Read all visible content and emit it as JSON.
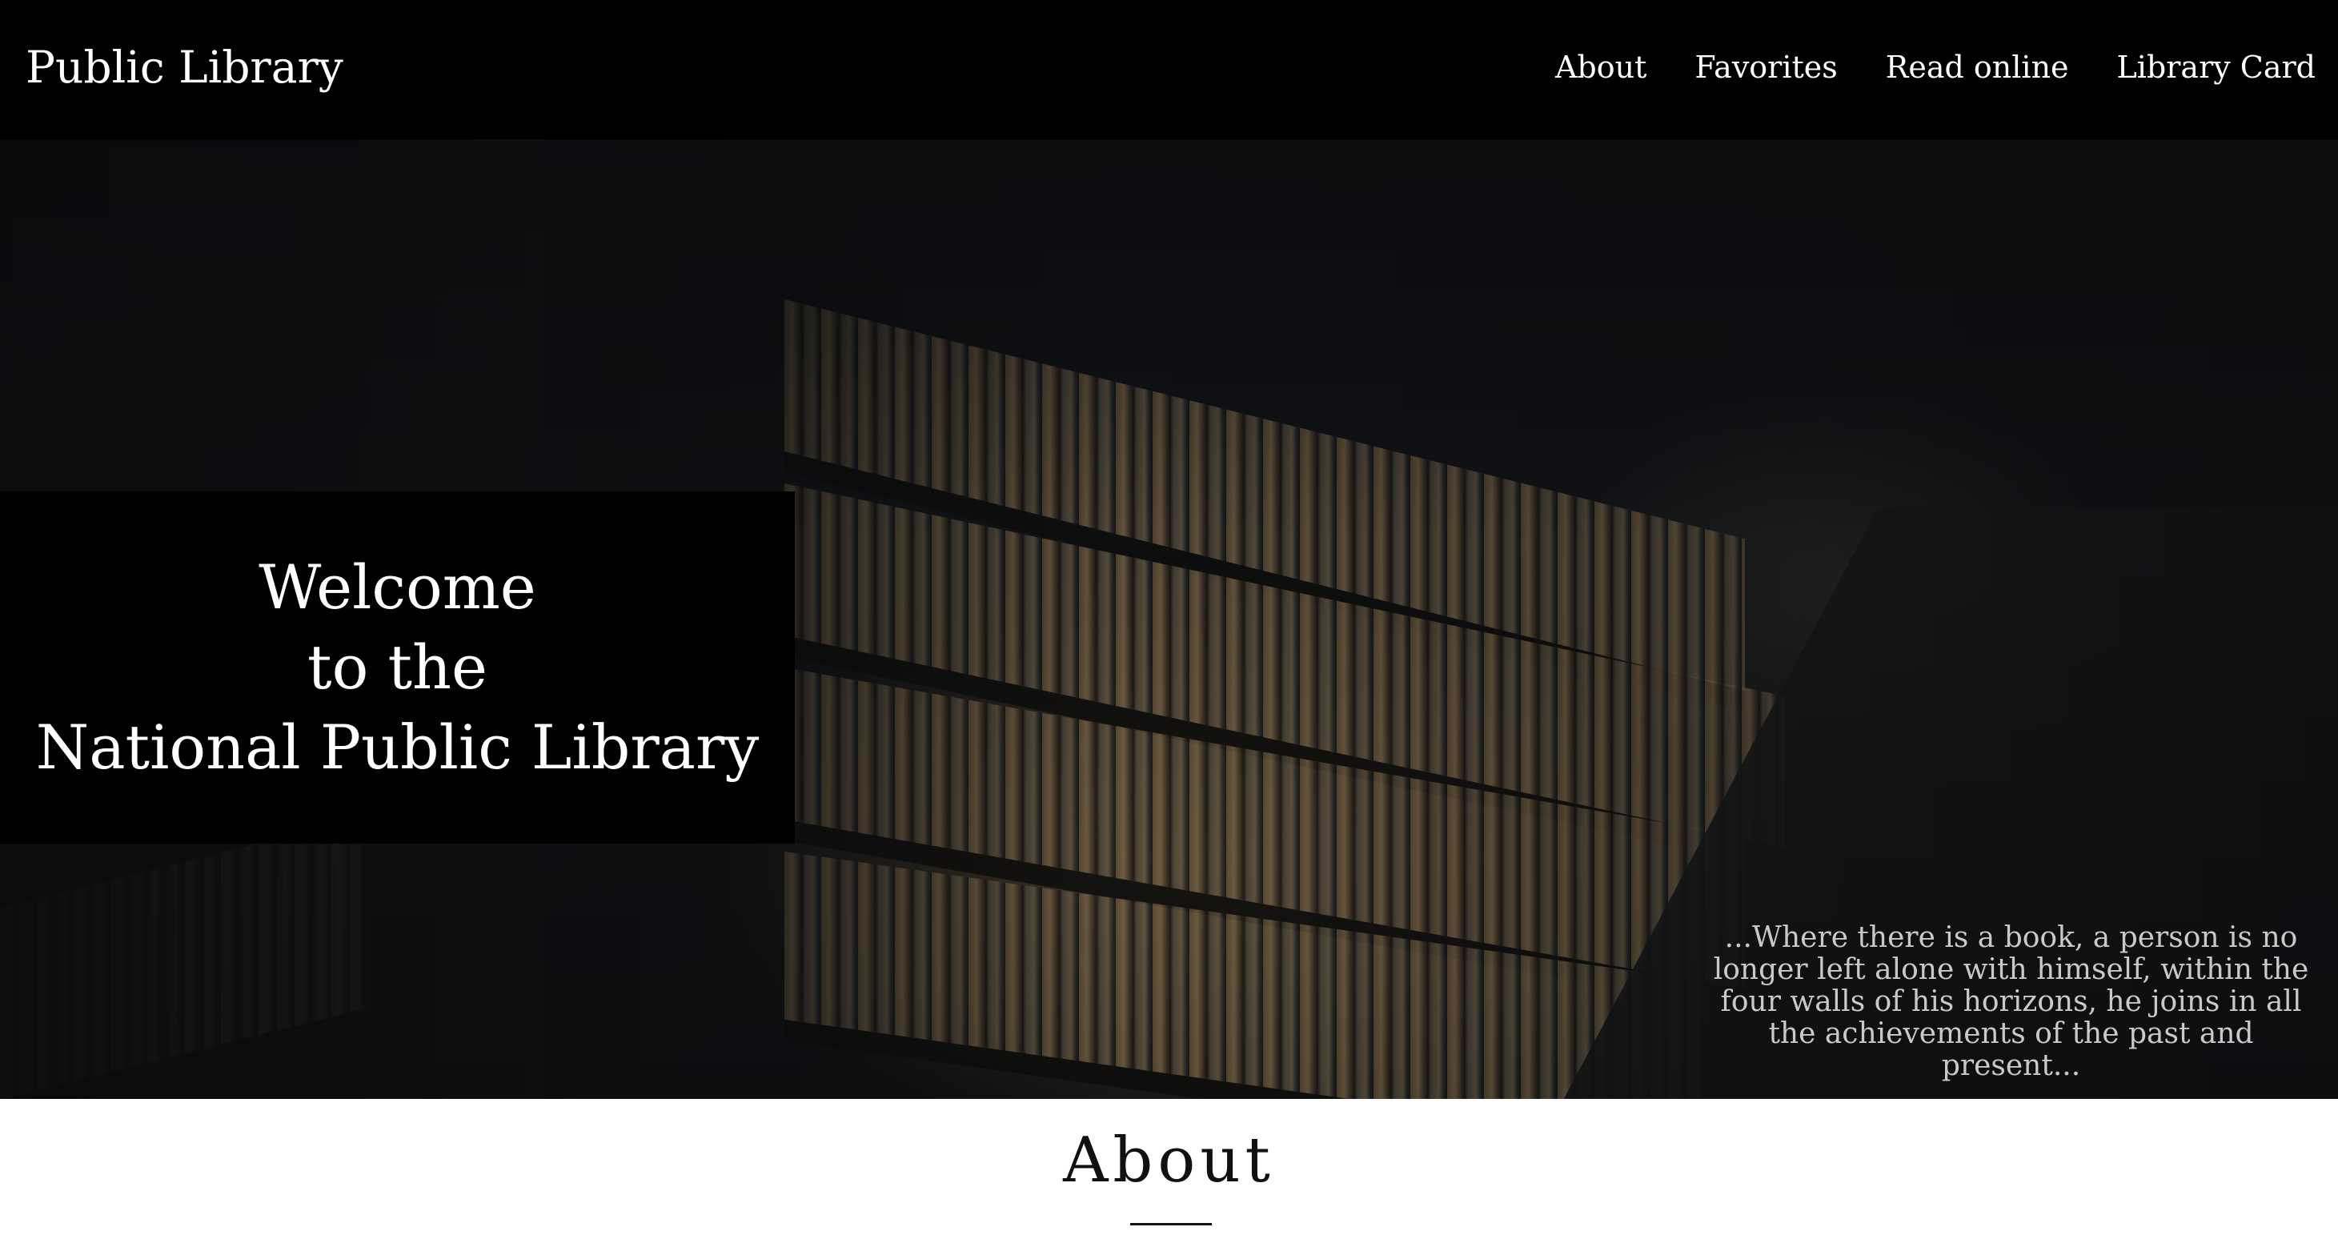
{
  "header": {
    "logo": "Public Library",
    "nav": [
      {
        "label": "About"
      },
      {
        "label": "Favorites"
      },
      {
        "label": "Read online"
      },
      {
        "label": "Library Card"
      }
    ]
  },
  "hero": {
    "welcome": [
      "Welcome",
      "to the",
      "National Public Library"
    ],
    "quote": "...Where there is a book, a person is no longer left alone with himself, within the four walls of his horizons, he joins in all the achievements of the past and present..."
  },
  "about": {
    "title": "About"
  },
  "colors": {
    "header_bg": "#000000",
    "text_light": "#ffffff",
    "quote_text": "#c9c9c9",
    "page_bg": "#ffffff"
  }
}
